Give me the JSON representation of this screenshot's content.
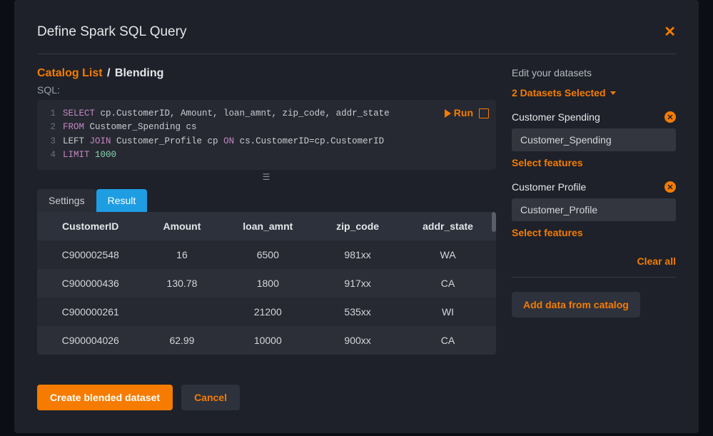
{
  "modal": {
    "title": "Define Spark SQL Query",
    "close_label": "✕"
  },
  "breadcrumb": {
    "root": "Catalog List",
    "current": "Blending"
  },
  "sql_label": "SQL:",
  "editor": {
    "lines": [
      {
        "n": "1",
        "kw1": "SELECT",
        "rest": " cp.CustomerID, Amount, loan_amnt, zip_code, addr_state"
      },
      {
        "n": "2",
        "kw1": "FROM",
        "rest": " Customer_Spending cs"
      },
      {
        "n": "3",
        "pre": "LEFT ",
        "kw1": "JOIN",
        "mid": " Customer_Profile cp ",
        "kw2": "ON",
        "rest2": " cs.CustomerID=cp.CustomerID"
      },
      {
        "n": "4",
        "kw1": "LIMIT",
        "lit": " 1000"
      }
    ],
    "run_label": "Run"
  },
  "tabs": {
    "settings": "Settings",
    "result": "Result"
  },
  "table": {
    "columns": [
      "CustomerID",
      "Amount",
      "loan_amnt",
      "zip_code",
      "addr_state"
    ],
    "rows": [
      [
        "C900002548",
        "16",
        "6500",
        "981xx",
        "WA"
      ],
      [
        "C900000436",
        "130.78",
        "1800",
        "917xx",
        "CA"
      ],
      [
        "C900000261",
        "",
        "21200",
        "535xx",
        "WI"
      ],
      [
        "C900004026",
        "62.99",
        "10000",
        "900xx",
        "CA"
      ]
    ]
  },
  "footer": {
    "create_label": "Create blended dataset",
    "cancel_label": "Cancel"
  },
  "right": {
    "edit_label": "Edit your datasets",
    "datasets_selected": "2 Datasets Selected",
    "datasets": [
      {
        "title": "Customer Spending",
        "chip": "Customer_Spending",
        "select_features": "Select features"
      },
      {
        "title": "Customer Profile",
        "chip": "Customer_Profile",
        "select_features": "Select features"
      }
    ],
    "clear_all": "Clear all",
    "add_data": "Add data from catalog"
  }
}
